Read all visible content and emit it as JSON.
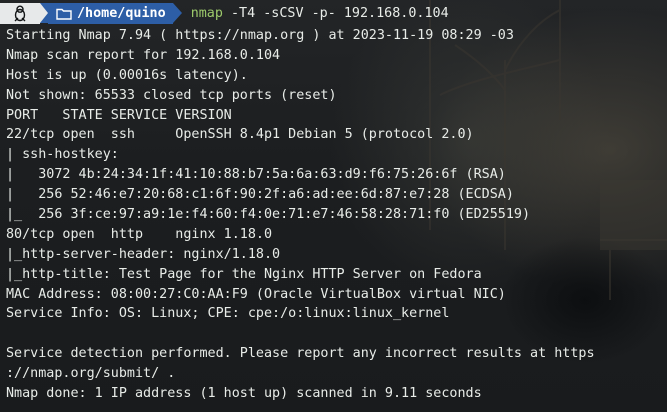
{
  "prompt": {
    "os_icon": "linux-tux-icon",
    "folder_icon": "folder-icon",
    "directory": "/home/quino",
    "command_name": "nmap",
    "command_args": " -T4 -sCSV -p- 192.168.0.104"
  },
  "output_lines_1": [
    "Starting Nmap 7.94 ( https://nmap.org ) at 2023-11-19 08:29 -03",
    "Nmap scan report for 192.168.0.104",
    "Host is up (0.00016s latency).",
    "Not shown: 65533 closed tcp ports (reset)",
    "PORT   STATE SERVICE VERSION",
    "22/tcp open  ssh     OpenSSH 8.4p1 Debian 5 (protocol 2.0)",
    "| ssh-hostkey: ",
    "|   3072 4b:24:34:1f:41:10:88:b7:5a:6a:63:d9:f6:75:26:6f (RSA)",
    "|   256 52:46:e7:20:68:c1:6f:90:2f:a6:ad:ee:6d:87:e7:28 (ECDSA)",
    "|_  256 3f:ce:97:a9:1e:f4:60:f4:0e:71:e7:46:58:28:71:f0 (ED25519)",
    "80/tcp open  http    nginx 1.18.0",
    "|_http-server-header: nginx/1.18.0",
    "|_http-title: Test Page for the Nginx HTTP Server on Fedora",
    "MAC Address: 08:00:27:C0:AA:F9 (Oracle VirtualBox virtual NIC)",
    "Service Info: OS: Linux; CPE: cpe:/o:linux:linux_kernel"
  ],
  "output_lines_2": [
    "Service detection performed. Please report any incorrect results at https",
    "://nmap.org/submit/ .",
    "Nmap done: 1 IP address (1 host up) scanned in 9.11 seconds"
  ],
  "colors": {
    "command": "#9cc96b",
    "directory_bg": "#2d5ea6",
    "os_bg": "#e7e9ea",
    "text": "#e8ece8"
  }
}
